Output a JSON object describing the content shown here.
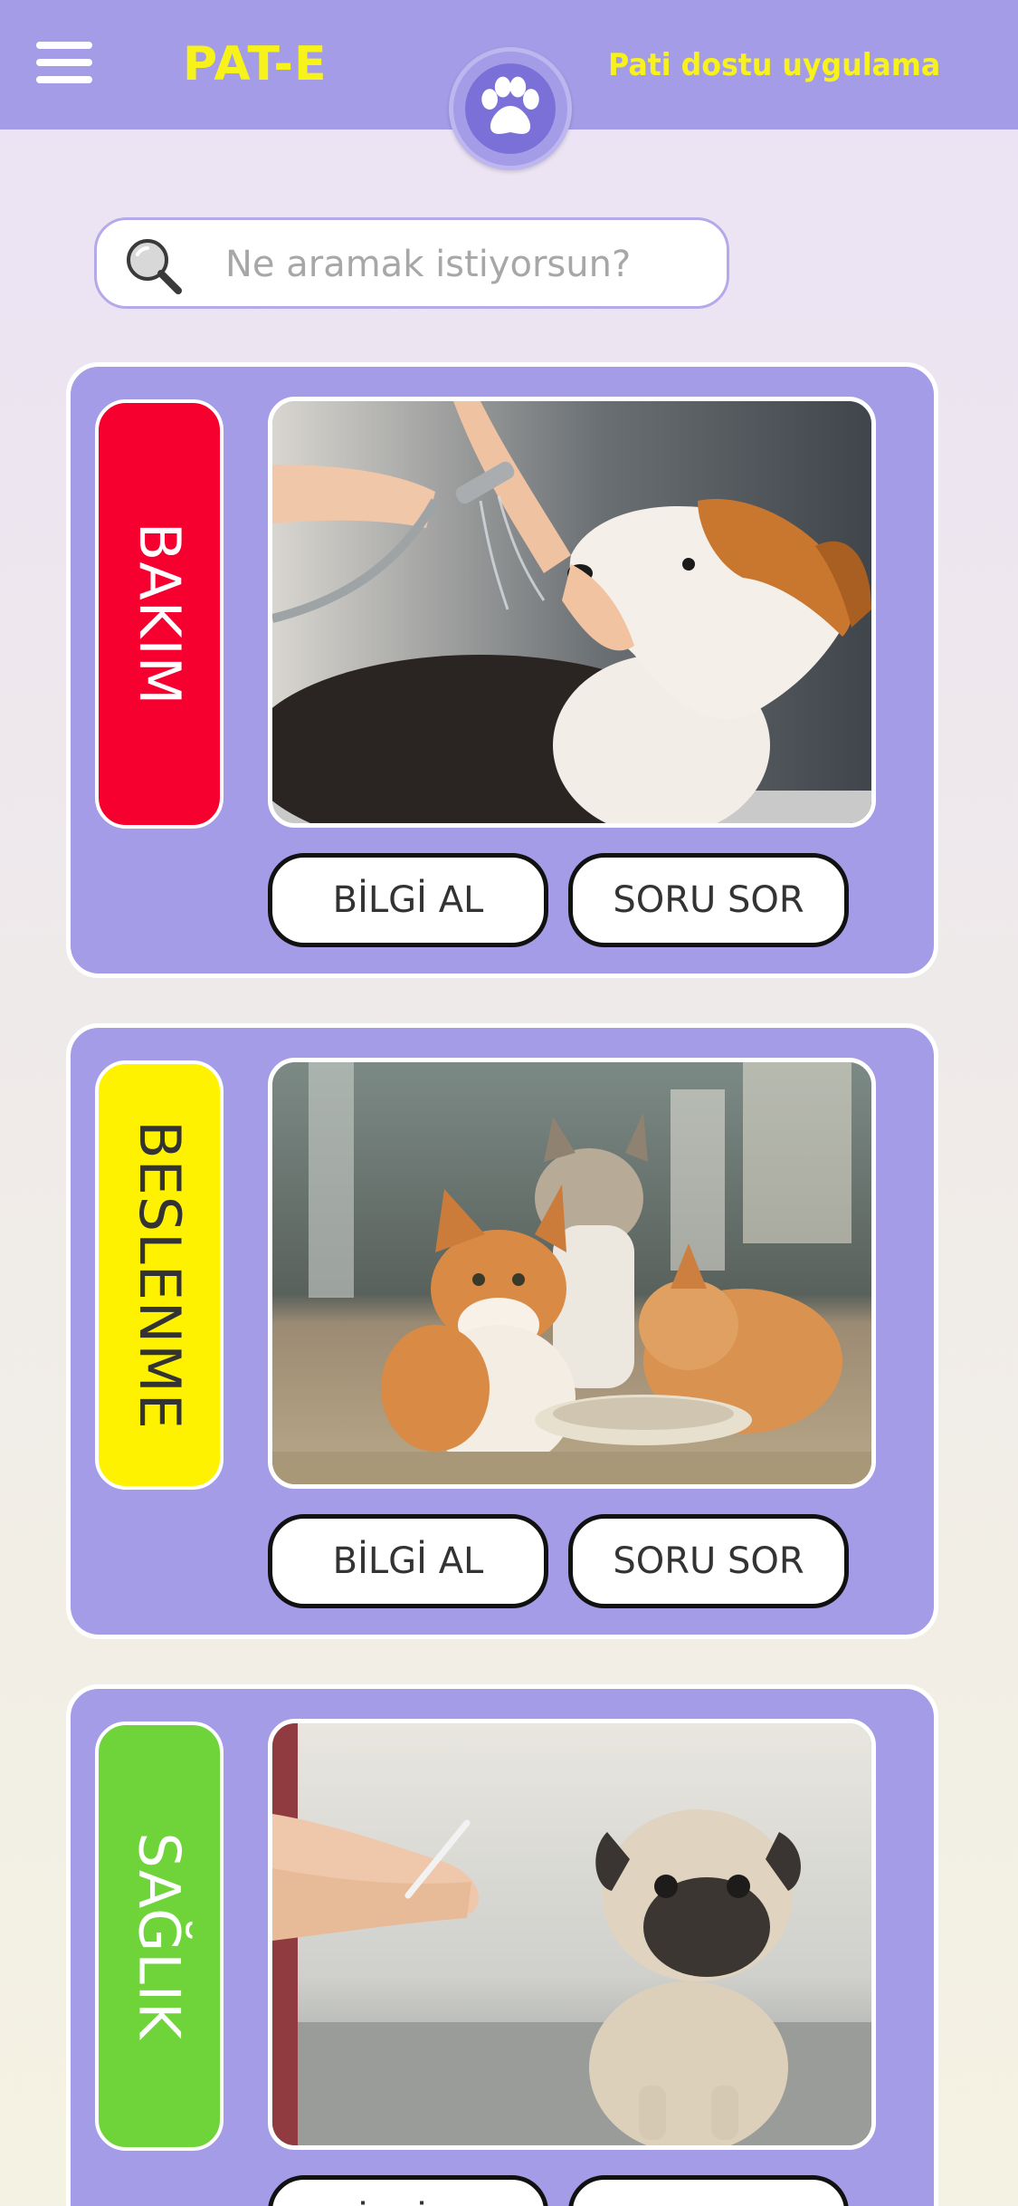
{
  "header": {
    "title": "PAT-E",
    "tagline": "Pati dostu uygulama",
    "menu_icon": "hamburger-menu-icon",
    "logo_icon": "paw-icon",
    "colors": {
      "bar": "#a49ce6",
      "title": "#f7f21a"
    }
  },
  "search": {
    "placeholder": "Ne aramak istiyorsun?",
    "value": "",
    "icon": "search-icon"
  },
  "cards": [
    {
      "label": "BAKIM",
      "label_bg": "#f5002f",
      "label_color": "#ffffff",
      "photo": "dog being washed with shower head",
      "info_button": "BİLGİ AL",
      "ask_button": "SORU SOR"
    },
    {
      "label": "BESLENME",
      "label_bg": "#fff200",
      "label_color": "#333333",
      "photo": "three kittens drinking from a bowl",
      "info_button": "BİLGİ AL",
      "ask_button": "SORU SOR"
    },
    {
      "label": "SAĞLIK",
      "label_bg": "#6ed43a",
      "label_color": "#ffffff",
      "photo": "pug puppy at the veterinarian",
      "info_button": "BİLGİ AL",
      "ask_button": "SORU SOR"
    }
  ]
}
